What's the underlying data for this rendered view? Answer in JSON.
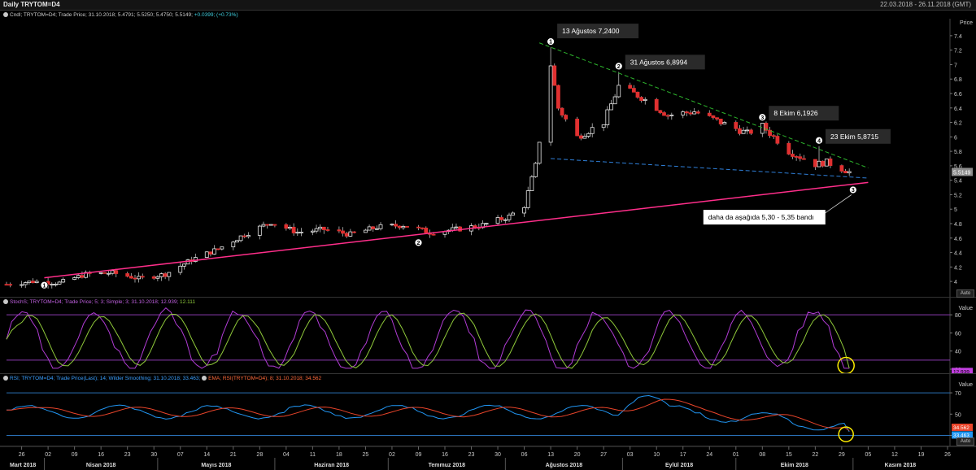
{
  "header": {
    "title": "Daily TRYTOM=D4",
    "date_range": "22.03.2018 - 26.11.2018 (GMT)"
  },
  "price_pane": {
    "legend": {
      "series_label": "Cndl; TRYTOM=D4; Trade Price; 31.10.2018; 5.4791; 5.5250; 5.4750; 5.5149;",
      "change": "+0.0399; (+0.73%)"
    },
    "axis_title": "Price",
    "last_price": "5.5149",
    "auto_label": "Auto"
  },
  "stoch_pane": {
    "legend": {
      "series_label": "StochS; TRYTOM=D4; Trade Price; 5; 3; Simple; 3; 31.10.2018;",
      "k_value": "12.939;",
      "d_value": "12.111"
    },
    "axis_title": "Value",
    "k_badge": "12.939",
    "d_badge": "12.111"
  },
  "rsi_pane": {
    "legend": {
      "rsi_label": "RSI; TRYTOM=D4; Trade Price(Last); 14; Wilder Smoothing; 31.10.2018; 33.463;",
      "ema_label": "EMA; RSI(TRYTOM=D4); 8; 31.10.2018; 34.562"
    },
    "axis_title": "Value",
    "ema_badge": "34.562",
    "rsi_badge": "33.463",
    "auto_label": "Auto"
  },
  "annotations": [
    {
      "number": "1",
      "text": "13 Ağustos 7,2400"
    },
    {
      "number": "2",
      "text": "31 Ağustos 6,8994"
    },
    {
      "number": "3",
      "text": "8 Ekim 6,1926"
    },
    {
      "number": "4",
      "text": "23 Ekim 5,8715"
    }
  ],
  "support_labels": [
    "1",
    "2",
    "3"
  ],
  "note": "daha da aşağıda 5,30 - 5,35 bandı",
  "colors": {
    "up_candle": "#ffffff",
    "down_candle": "#e03030",
    "support_line": "#ff2e8a",
    "resistance_line": "#2db52d",
    "mid_line": "#2f7fd8",
    "stoch_k": "#b23cd6",
    "stoch_d": "#8fc93a",
    "rsi": "#2196f3",
    "ema": "#e8442a",
    "highlight": "#ffee00"
  },
  "chart_data": [
    {
      "type": "candlestick",
      "title": "Daily TRYTOM=D4",
      "ylabel": "Price",
      "ylim": [
        3.9,
        7.5
      ],
      "y_ticks": [
        4,
        4.2,
        4.4,
        4.6,
        4.8,
        5,
        5.2,
        5.4,
        5.6,
        5.8,
        6,
        6.2,
        6.4,
        6.6,
        6.8,
        7,
        7.2,
        7.4
      ],
      "x_tick_labels": [
        "26",
        "02",
        "09",
        "16",
        "23",
        "30",
        "07",
        "14",
        "21",
        "28",
        "04",
        "11",
        "18",
        "25",
        "02",
        "09",
        "16",
        "23",
        "30",
        "06",
        "13",
        "20",
        "27",
        "03",
        "10",
        "17",
        "24",
        "01",
        "08",
        "15",
        "22",
        "29",
        "05",
        "12",
        "19",
        "26"
      ],
      "month_labels": [
        "Mart 2018",
        "Nisan 2018",
        "Mayıs 2018",
        "Haziran 2018",
        "Temmuz 2018",
        "Ağustos 2018",
        "Eylül 2018",
        "Ekim 2018",
        "Kasım 2018"
      ],
      "close_path": [
        [
          "2018-03-22",
          3.96
        ],
        [
          "2018-03-29",
          4.0
        ],
        [
          "2018-04-05",
          3.98
        ],
        [
          "2018-04-12",
          4.1
        ],
        [
          "2018-04-19",
          4.12
        ],
        [
          "2018-04-26",
          4.04
        ],
        [
          "2018-05-03",
          4.1
        ],
        [
          "2018-05-10",
          4.3
        ],
        [
          "2018-05-17",
          4.45
        ],
        [
          "2018-05-24",
          4.65
        ],
        [
          "2018-05-31",
          4.82
        ],
        [
          "2018-06-07",
          4.68
        ],
        [
          "2018-06-14",
          4.72
        ],
        [
          "2018-06-21",
          4.65
        ],
        [
          "2018-06-28",
          4.75
        ],
        [
          "2018-07-05",
          4.78
        ],
        [
          "2018-07-12",
          4.68
        ],
        [
          "2018-07-19",
          4.72
        ],
        [
          "2018-07-26",
          4.78
        ],
        [
          "2018-08-02",
          4.9
        ],
        [
          "2018-08-06",
          5.05
        ],
        [
          "2018-08-09",
          5.6
        ],
        [
          "2018-08-13",
          7.0
        ],
        [
          "2018-08-15",
          6.4
        ],
        [
          "2018-08-20",
          6.0
        ],
        [
          "2018-08-27",
          6.2
        ],
        [
          "2018-08-31",
          6.7
        ],
        [
          "2018-09-06",
          6.55
        ],
        [
          "2018-09-13",
          6.3
        ],
        [
          "2018-09-20",
          6.35
        ],
        [
          "2018-09-27",
          6.2
        ],
        [
          "2018-10-04",
          6.05
        ],
        [
          "2018-10-08",
          6.15
        ],
        [
          "2018-10-15",
          5.8
        ],
        [
          "2018-10-22",
          5.62
        ],
        [
          "2018-10-25",
          5.65
        ],
        [
          "2018-10-31",
          5.5149
        ]
      ],
      "highs": [
        {
          "date": "2018-08-13",
          "value": 7.24
        },
        {
          "date": "2018-08-31",
          "value": 6.8994
        },
        {
          "date": "2018-10-08",
          "value": 6.1926
        },
        {
          "date": "2018-10-23",
          "value": 5.8715
        }
      ],
      "last": 5.5149,
      "trendlines": [
        {
          "name": "support",
          "from": [
            "2018-04-01",
            4.05
          ],
          "to": [
            "2018-11-05",
            5.37
          ]
        },
        {
          "name": "resistance",
          "from": [
            "2018-08-10",
            7.3
          ],
          "to": [
            "2018-11-05",
            5.57
          ]
        },
        {
          "name": "mid",
          "from": [
            "2018-08-13",
            5.7
          ],
          "to": [
            "2018-11-05",
            5.43
          ]
        }
      ]
    },
    {
      "type": "line",
      "title": "StochS",
      "ylabel": "Value",
      "ylim": [
        20,
        90
      ],
      "y_ticks": [
        20,
        40,
        60,
        80
      ],
      "reference_lines": [
        80,
        30
      ],
      "series": [
        {
          "name": "%K",
          "last": 12.939
        },
        {
          "name": "%D",
          "last": 12.111
        }
      ]
    },
    {
      "type": "line",
      "title": "RSI",
      "ylabel": "Value",
      "ylim": [
        25,
        80
      ],
      "y_ticks": [
        30,
        50,
        70
      ],
      "reference_lines": [
        70,
        30
      ],
      "series": [
        {
          "name": "RSI",
          "last": 33.463
        },
        {
          "name": "EMA",
          "last": 34.562
        }
      ]
    }
  ]
}
